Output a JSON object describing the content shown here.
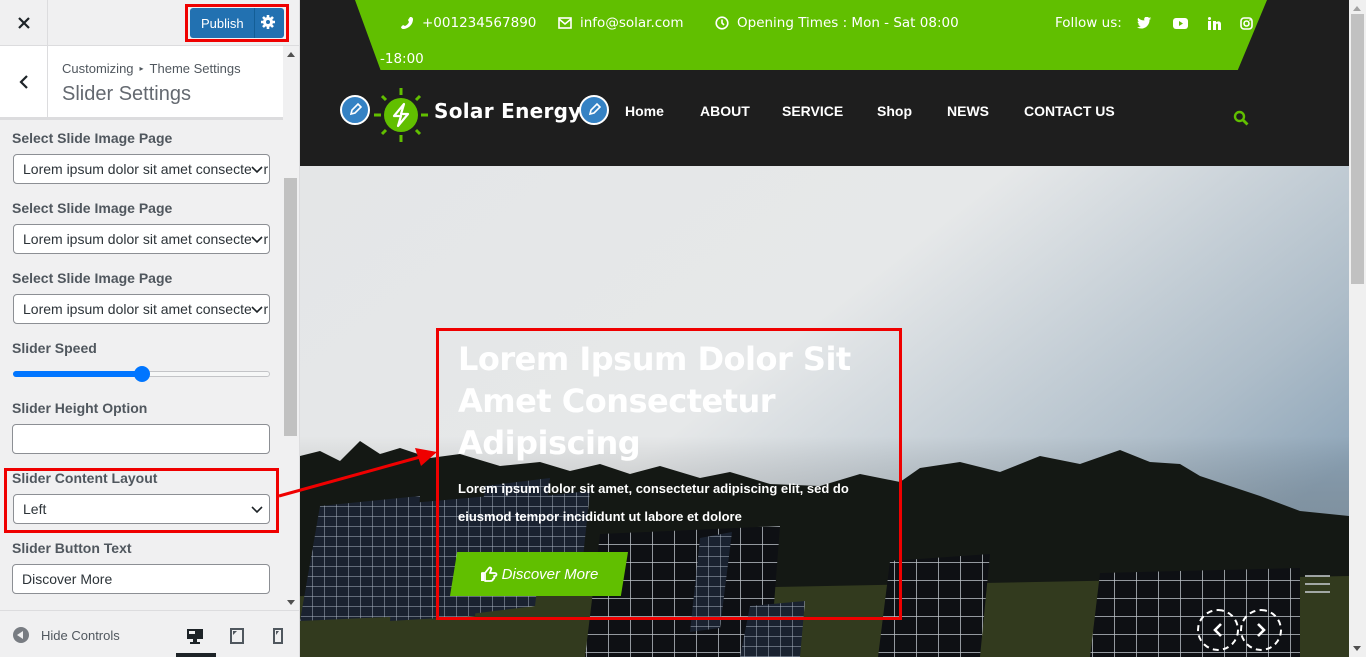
{
  "customizer": {
    "close_label": "×",
    "publish_label": "Publish",
    "breadcrumb": {
      "root": "Customizing",
      "separator": "▸",
      "section": "Theme Settings"
    },
    "title": "Slider Settings",
    "controls": [
      {
        "label": "Select Slide Image Page",
        "type": "select",
        "value": "Lorem ipsum dolor sit amet consectetur"
      },
      {
        "label": "Select Slide Image Page",
        "type": "select",
        "value": "Lorem ipsum dolor sit amet consectetur"
      },
      {
        "label": "Select Slide Image Page",
        "type": "select",
        "value": "Lorem ipsum dolor sit amet consectetur"
      },
      {
        "label": "Slider Speed",
        "type": "range",
        "value_fraction": 0.5
      },
      {
        "label": "Slider Height Option",
        "type": "text",
        "value": ""
      },
      {
        "label": "Slider Content Layout",
        "type": "select",
        "value": "Left"
      },
      {
        "label": "Slider Button Text",
        "type": "text",
        "value": "Discover More"
      }
    ],
    "footer": {
      "hide_controls_label": "Hide Controls",
      "devices": [
        "desktop",
        "tablet",
        "mobile"
      ],
      "active_device": "desktop"
    }
  },
  "site": {
    "topbar": {
      "phone": "+001234567890",
      "email": "info@solar.com",
      "hours": "Opening Times : Mon - Sat 08:00",
      "hours_wrap": "-18:00",
      "follow_label": "Follow us:",
      "social": [
        "twitter",
        "youtube",
        "linkedin",
        "instagram"
      ]
    },
    "logo_text": "Solar Energy",
    "nav": [
      "Home",
      "ABOUT",
      "SERVICE",
      "Shop",
      "NEWS",
      "CONTACT US"
    ],
    "hero": {
      "title": "Lorem Ipsum Dolor Sit Amet Consectetur Adipiscing",
      "description": "Lorem ipsum dolor sit amet, consectetur adipiscing elit, sed do eiusmod tempor incididunt ut labore et dolore",
      "button_label": "Discover More"
    }
  },
  "colors": {
    "brand_green": "#61bf00",
    "publish_blue": "#2271b1",
    "annotation_red": "#ef0000",
    "header_dark": "#1e1e1e"
  }
}
